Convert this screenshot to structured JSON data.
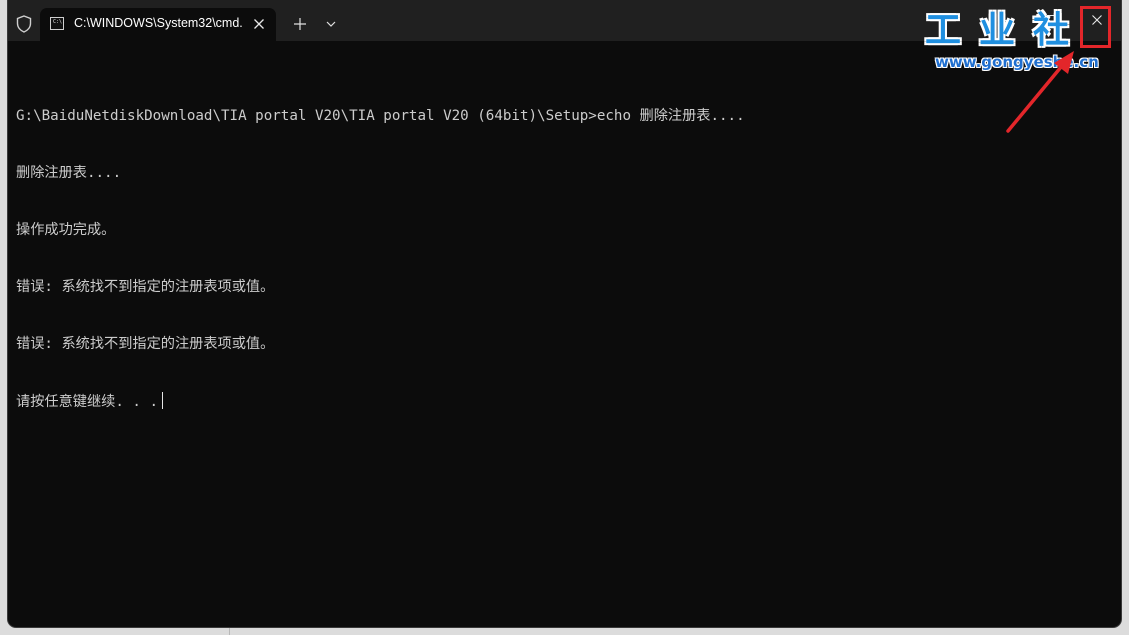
{
  "tab": {
    "icon_text": "C:\\.",
    "title": "C:\\WINDOWS\\System32\\cmd.",
    "close_icon": "close-icon"
  },
  "titlebar": {
    "new_tab_icon": "plus-icon",
    "dropdown_icon": "chevron-down-icon",
    "shield_icon": "shield-icon"
  },
  "window_controls": {
    "minimize_icon": "minimize-icon",
    "maximize_icon": "maximize-icon",
    "close_icon": "close-icon"
  },
  "console": {
    "lines": [
      "G:\\BaiduNetdiskDownload\\TIA portal V20\\TIA portal V20 (64bit)\\Setup>echo 删除注册表....",
      "删除注册表....",
      "操作成功完成。",
      "错误: 系统找不到指定的注册表项或值。",
      "错误: 系统找不到指定的注册表项或值。",
      "请按任意键继续. . ."
    ],
    "foreground": "#cccccc",
    "background": "#0c0c0c"
  },
  "watermark": {
    "title": "工业社",
    "url": "www.gongyeshe.cn",
    "color": "#1f8fe0"
  },
  "annotation": {
    "color": "#e3262a"
  }
}
